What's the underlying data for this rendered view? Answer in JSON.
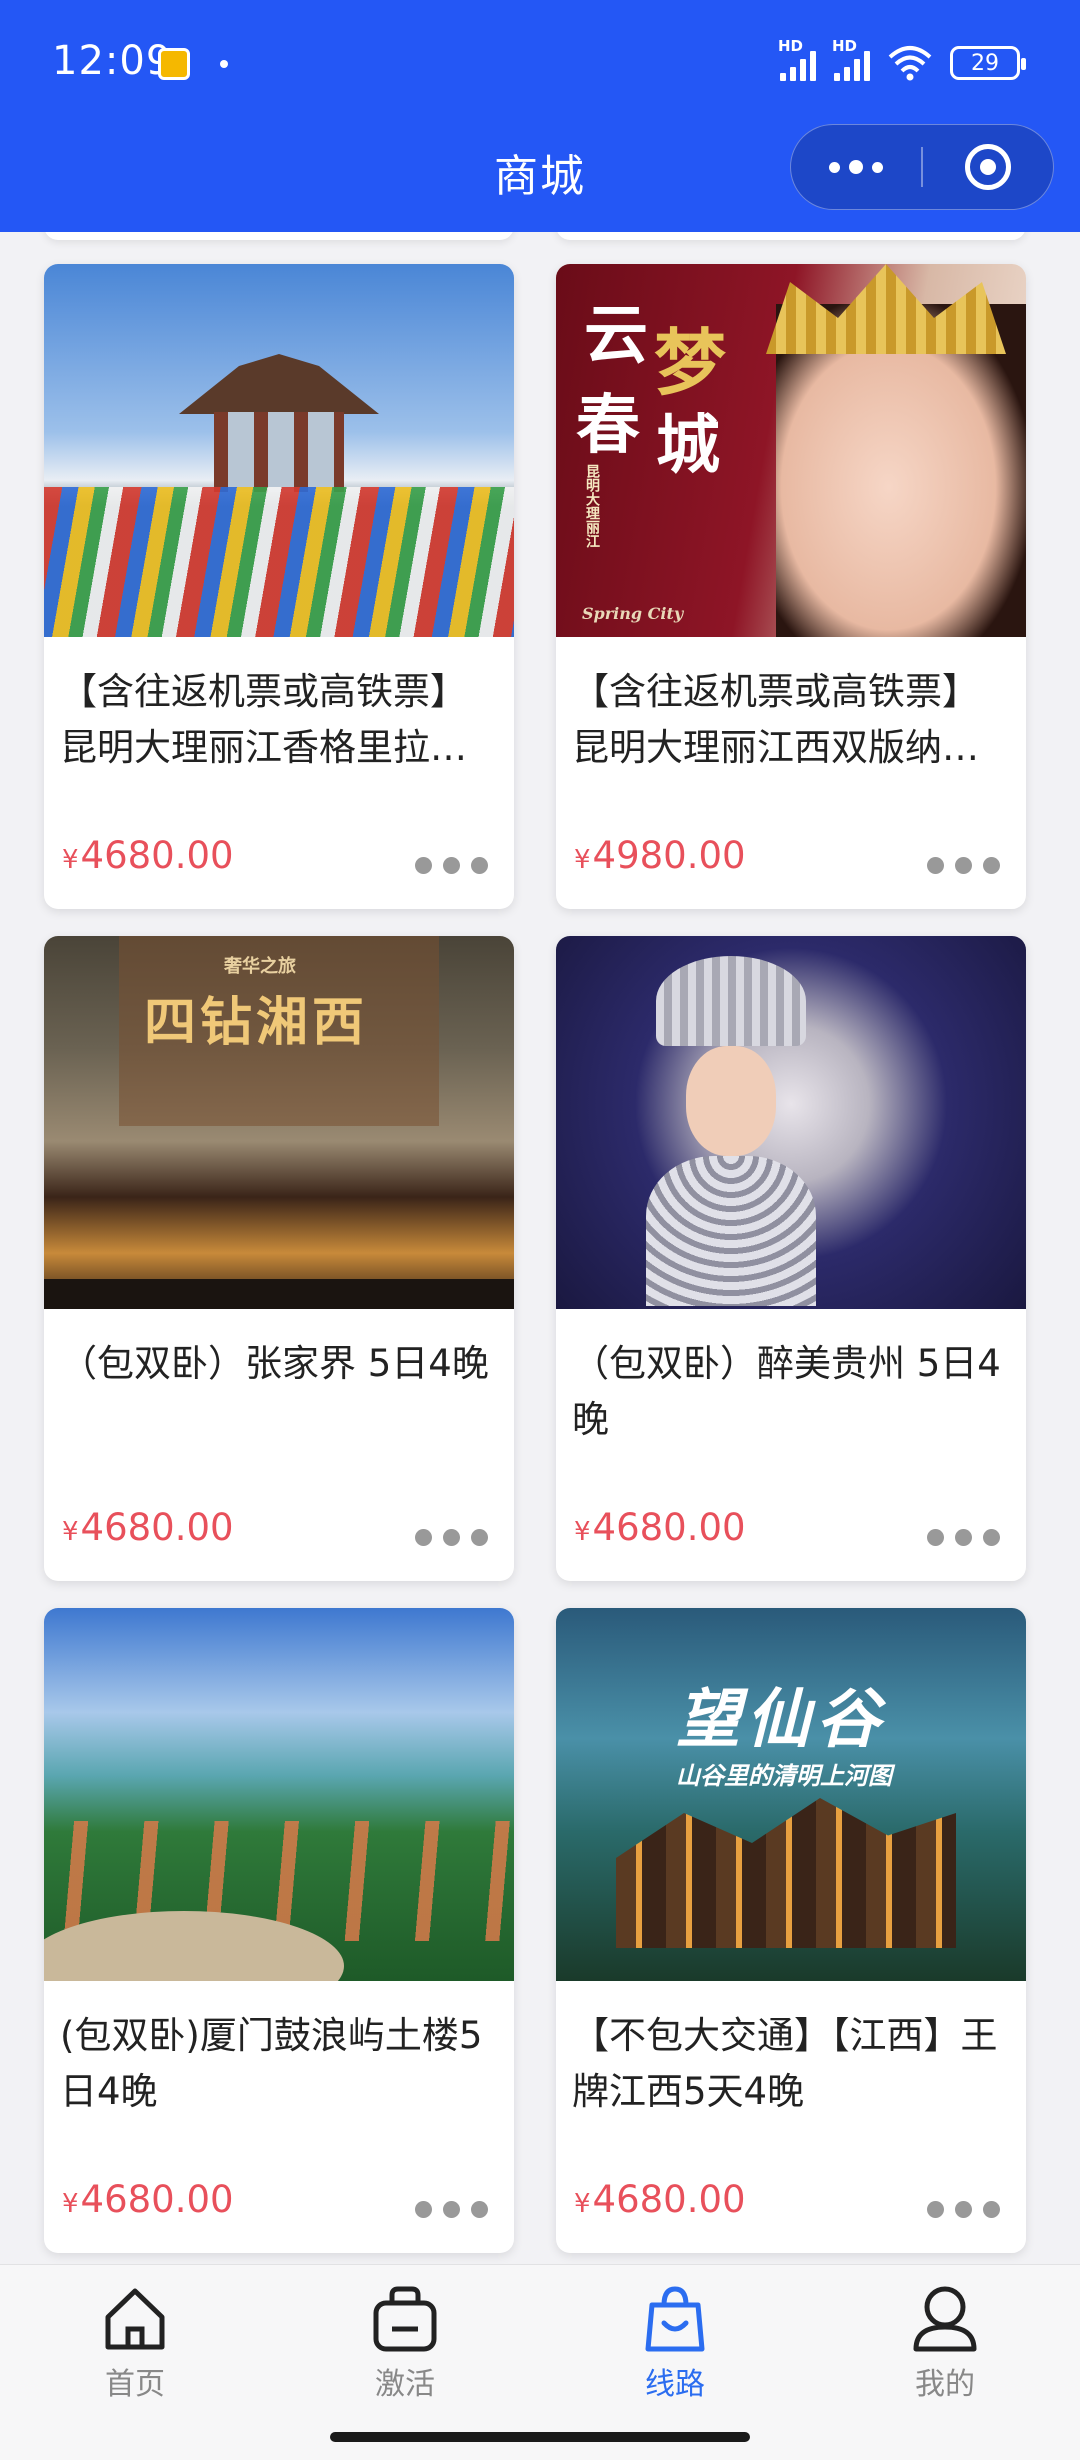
{
  "status_bar": {
    "time": "12:09",
    "battery": "29"
  },
  "nav": {
    "title": "商城"
  },
  "products": [
    {
      "title": "【含往返机票或高铁票】昆明大理丽江香格里拉…",
      "currency": "¥",
      "price": "4680.00"
    },
    {
      "title": "【含往返机票或高铁票】昆明大理丽江西双版纳…",
      "currency": "¥",
      "price": "4980.00",
      "thumb_text": {
        "a": "云",
        "b": "梦",
        "c": "春",
        "d": "城",
        "side": "昆明大理丽江",
        "caption": "Spring City"
      }
    },
    {
      "title": "（包双卧）张家界 5日4晚",
      "currency": "¥",
      "price": "4680.00",
      "thumb_text": {
        "top": "奢华之旅",
        "main": "四钻湘西"
      }
    },
    {
      "title": "（包双卧）醉美贵州 5日4晚",
      "currency": "¥",
      "price": "4680.00"
    },
    {
      "title": "(包双卧)厦门鼓浪屿土楼5日4晚",
      "currency": "¥",
      "price": "4680.00"
    },
    {
      "title": "【不包大交通】【江西】王牌江西5天4晚",
      "currency": "¥",
      "price": "4680.00",
      "thumb_text": {
        "main": "望仙谷",
        "sub": "山谷里的清明上河图"
      }
    }
  ],
  "tabbar": {
    "items": [
      {
        "label": "首页",
        "icon": "home-icon"
      },
      {
        "label": "激活",
        "icon": "activate-bag-icon"
      },
      {
        "label": "线路",
        "icon": "route-bag-icon",
        "active": true
      },
      {
        "label": "我的",
        "icon": "user-icon"
      }
    ],
    "active_color": "#2b6df0"
  },
  "colors": {
    "header": "#2457f5",
    "price": "#e8505b"
  }
}
